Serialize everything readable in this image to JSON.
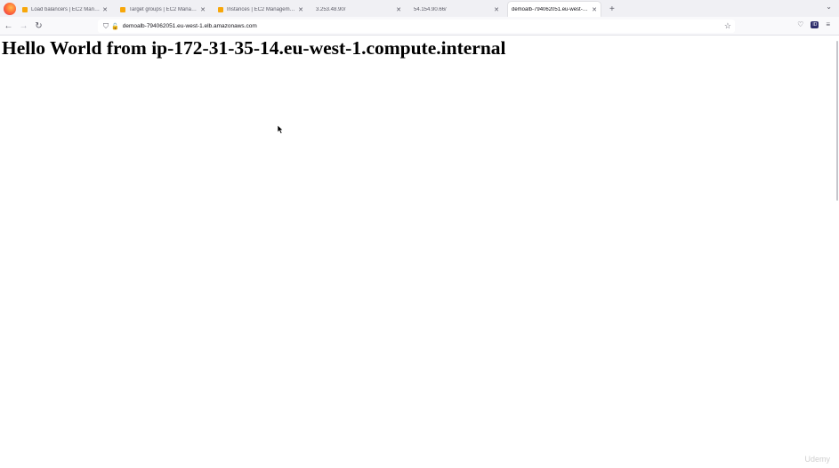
{
  "browser": {
    "tabs": [
      {
        "title": "Load balancers | EC2 Managem",
        "has_favicon": true,
        "active": false
      },
      {
        "title": "Target groups | EC2 Managem",
        "has_favicon": true,
        "active": false
      },
      {
        "title": "Instances | EC2 Management Co",
        "has_favicon": true,
        "active": false
      },
      {
        "title": "3.253.48.90/",
        "has_favicon": false,
        "active": false
      },
      {
        "title": "54.154.90.66/",
        "has_favicon": false,
        "active": false
      },
      {
        "title": "demoalb-794062051.eu-west-1.elb",
        "has_favicon": false,
        "active": true
      }
    ],
    "close_glyph": "✕",
    "new_tab_glyph": "+",
    "tab_list_glyph": "⌄",
    "back_glyph": "←",
    "forward_glyph": "→",
    "reload_glyph": "↻",
    "url": "demoalb-794062051.eu-west-1.elb.amazonaws.com",
    "shield_glyph": "⛉",
    "lock_glyph": "🔓",
    "star_glyph": "☆",
    "pocket_glyph": "♡",
    "extension_label": "ID",
    "menu_glyph": "≡"
  },
  "page": {
    "heading": "Hello World from ip-172-31-35-14.eu-west-1.compute.internal"
  },
  "watermark": "Udemy"
}
